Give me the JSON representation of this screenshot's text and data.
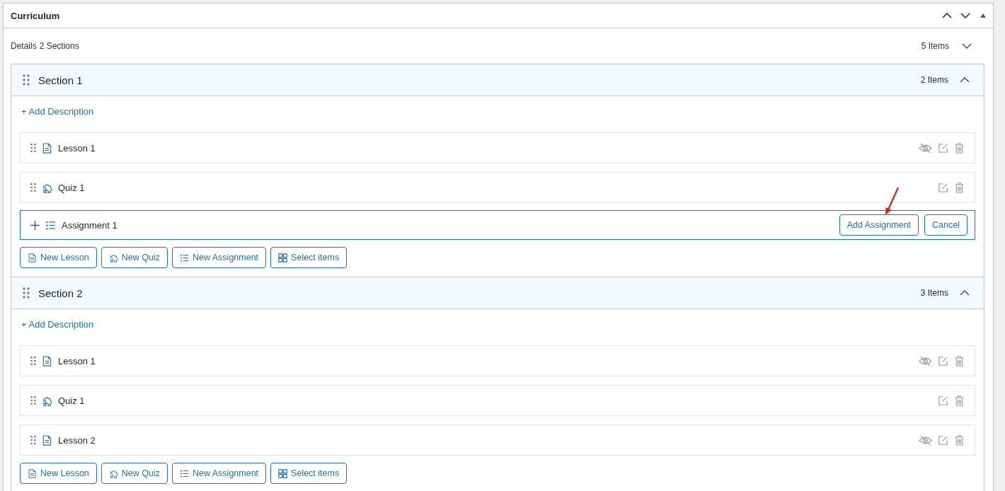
{
  "panel": {
    "title": "Curriculum"
  },
  "details": {
    "label": "Details",
    "sections_count": "2 Sections",
    "items_count": "5 Items"
  },
  "sections": [
    {
      "title": "Section 1",
      "items_count": "2 Items",
      "expanded": true,
      "add_description": "+ Add Description",
      "items": [
        {
          "kind": "lesson",
          "title": "Lesson 1"
        },
        {
          "kind": "quiz",
          "title": "Quiz 1"
        }
      ],
      "new_item": {
        "kind": "assignment",
        "value": "Assignment 1",
        "submit": "Add Assignment",
        "cancel": "Cancel"
      },
      "buttons": [
        {
          "kind": "lesson",
          "label": "New Lesson"
        },
        {
          "kind": "quiz",
          "label": "New Quiz"
        },
        {
          "kind": "assignment",
          "label": "New Assignment"
        },
        {
          "kind": "select",
          "label": "Select items"
        }
      ]
    },
    {
      "title": "Section 2",
      "items_count": "3 Items",
      "expanded": true,
      "add_description": "+ Add Description",
      "items": [
        {
          "kind": "lesson",
          "title": "Lesson 1"
        },
        {
          "kind": "quiz",
          "title": "Quiz 1"
        },
        {
          "kind": "lesson",
          "title": "Lesson 2"
        }
      ],
      "buttons": [
        {
          "kind": "lesson",
          "label": "New Lesson"
        },
        {
          "kind": "quiz",
          "label": "New Quiz"
        },
        {
          "kind": "assignment",
          "label": "New Assignment"
        },
        {
          "kind": "select",
          "label": "Select items"
        }
      ]
    }
  ]
}
